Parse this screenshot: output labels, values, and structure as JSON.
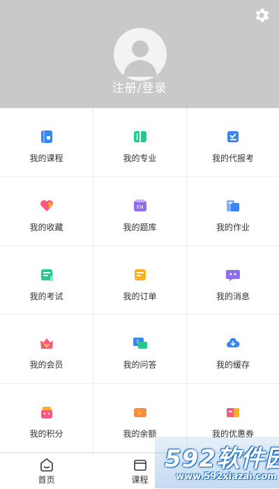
{
  "header": {
    "login_label": "注册/登录"
  },
  "menu": [
    {
      "label": "我的课程",
      "icon": "course-book-icon"
    },
    {
      "label": "我的专业",
      "icon": "major-book-icon"
    },
    {
      "label": "我的代报考",
      "icon": "exam-registration-icon"
    },
    {
      "label": "我的收藏",
      "icon": "heart-icon"
    },
    {
      "label": "我的题库",
      "icon": "question-bank-icon"
    },
    {
      "label": "我的作业",
      "icon": "homework-icon"
    },
    {
      "label": "我的考试",
      "icon": "exam-scroll-icon"
    },
    {
      "label": "我的订单",
      "icon": "order-icon"
    },
    {
      "label": "我的消息",
      "icon": "message-icon"
    },
    {
      "label": "我的会员",
      "icon": "vip-crown-icon"
    },
    {
      "label": "我的问答",
      "icon": "qa-icon"
    },
    {
      "label": "我的缓存",
      "icon": "cloud-download-icon"
    },
    {
      "label": "我的积分",
      "icon": "points-gift-icon"
    },
    {
      "label": "我的余额",
      "icon": "balance-icon"
    },
    {
      "label": "我的优惠券",
      "icon": "coupon-icon"
    }
  ],
  "tabbar": {
    "home_label": "首页",
    "course_label": "课程"
  },
  "watermark": {
    "title": "592软件园",
    "url": "www.592xiazai.com"
  },
  "colors": {
    "header_bg": "#c9c9c9",
    "blue": "#3a86f0",
    "green": "#25c98a",
    "pink": "#ff5a7e",
    "purple": "#8f6bf0",
    "orange": "#ffb020"
  }
}
